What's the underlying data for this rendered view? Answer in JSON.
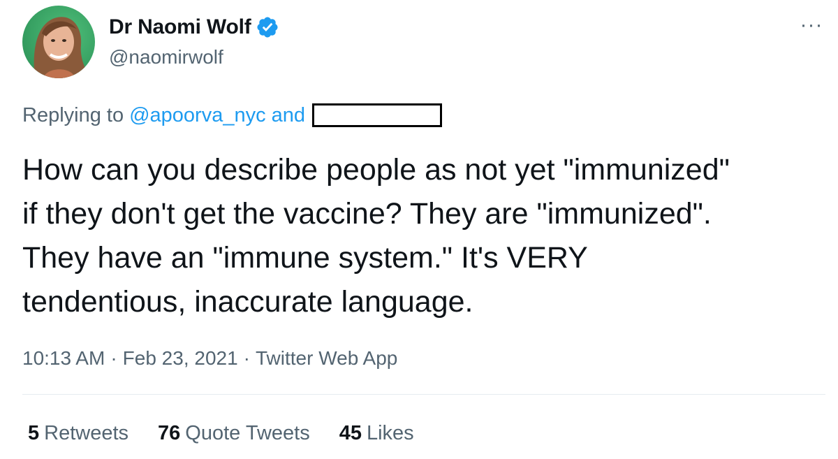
{
  "author": {
    "display_name": "Dr Naomi Wolf",
    "handle": "@naomirwolf",
    "verified_icon": "verified-badge-icon"
  },
  "more_menu": {
    "icon": "more-horizontal-icon",
    "label": "···"
  },
  "reply": {
    "prefix": "Replying to",
    "mention": "@apoorva_nyc",
    "conjunction": "and"
  },
  "tweet": {
    "lines": [
      "How can you describe people as not yet \"immunized\"",
      "if they don't get the vaccine? They are \"immunized\".",
      "They have an \"immune system.\" It's VERY",
      "tendentious, inaccurate language."
    ]
  },
  "meta": {
    "time": "10:13 AM",
    "separator": "·",
    "date": "Feb 23, 2021",
    "source": "Twitter Web App"
  },
  "stats": {
    "retweets_count": "5",
    "retweets_label": "Retweets",
    "quotes_count": "76",
    "quotes_label": "Quote Tweets",
    "likes_count": "45",
    "likes_label": "Likes"
  },
  "colors": {
    "link": "#1d9bf0",
    "secondary_text": "#536471",
    "primary_text": "#0f1419",
    "verified": "#1d9bf0"
  }
}
